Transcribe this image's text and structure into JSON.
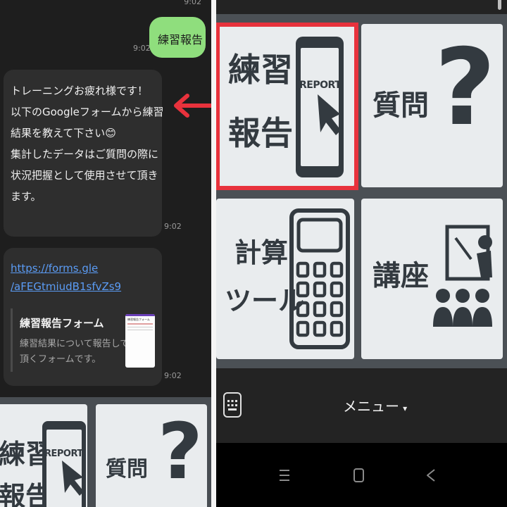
{
  "chat": {
    "top_time": "9:02",
    "user_message": "練習報告",
    "user_message_time": "9:02",
    "bot_message_lines": [
      "トレーニングお疲れ様です！",
      "以下のGoogleフォームから練習",
      "結果を教えて下さい😊",
      "集計したデータはご質問の際に",
      "状況把握として使用させて頂き",
      "ます。"
    ],
    "bot_message_time": "9:02",
    "link_line1": "https://forms.gle",
    "link_line2": "/aFEGtmiudB1sfvZs9",
    "preview_title": "練習報告フォーム",
    "preview_desc_line1": "練習結果について報告して",
    "preview_desc_line2": "頂くフォームです。",
    "preview_thumb_text": "練習報告フォーム",
    "link_message_time": "9:02"
  },
  "menu": {
    "tiles": {
      "report_line1": "練習",
      "report_line2": "報告",
      "report_badge": "REPORT",
      "question": "質問",
      "question_mark": "?",
      "calc_line1": "計算",
      "calc_line2": "ツール",
      "lecture": "講座"
    },
    "menu_label": "メニュー",
    "menu_caret": "▾"
  },
  "colors": {
    "highlight_border": "#e8323c",
    "arrow": "#e8323c",
    "user_bubble": "#8fde7d",
    "bot_bubble": "#2e2e2e",
    "tile_bg": "#e9ecee",
    "tile_ink": "#333a40",
    "link": "#5b9cf5"
  }
}
